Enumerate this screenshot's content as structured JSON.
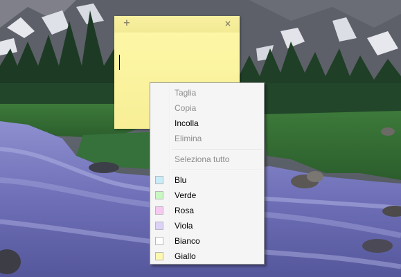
{
  "desktop": {
    "wallpaper": "mountain-forest-river"
  },
  "sticky_note": {
    "add_icon": "+",
    "close_icon": "×",
    "text": "",
    "color": "#fcf5a2"
  },
  "context_menu": {
    "edit_items": [
      {
        "label": "Taglia",
        "enabled": false
      },
      {
        "label": "Copia",
        "enabled": false
      },
      {
        "label": "Incolla",
        "enabled": true
      },
      {
        "label": "Elimina",
        "enabled": false
      }
    ],
    "select_all": {
      "label": "Seleziona tutto",
      "enabled": false
    },
    "colors": [
      {
        "label": "Blu",
        "swatch": "#c9ecf8"
      },
      {
        "label": "Verde",
        "swatch": "#c9f7c2"
      },
      {
        "label": "Rosa",
        "swatch": "#f7c9f1"
      },
      {
        "label": "Viola",
        "swatch": "#dcd2f7"
      },
      {
        "label": "Bianco",
        "swatch": "#ffffff"
      },
      {
        "label": "Giallo",
        "swatch": "#fdf7b0"
      }
    ]
  }
}
